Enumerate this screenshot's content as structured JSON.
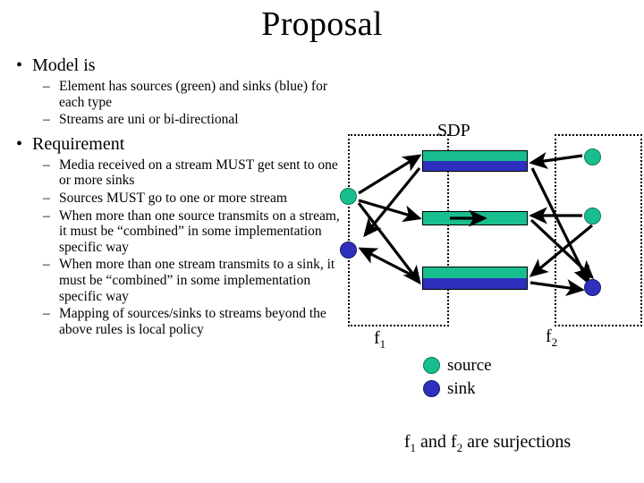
{
  "slide": {
    "title": "Proposal"
  },
  "bullets": [
    {
      "level1": "Model is",
      "marker": "•",
      "sub_marker": "–",
      "level2": [
        "Element has sources (green) and sinks (blue) for each type",
        "Streams are uni or bi-directional"
      ]
    },
    {
      "level1": "Requirement",
      "marker": "•",
      "sub_marker": "–",
      "level2": [
        "Media received on a stream MUST get sent to one or more sinks",
        "Sources MUST go to one or more stream",
        "When more than one source transmits on a stream, it must be “combined” in some implementation specific way",
        "When more than one stream transmits to a sink, it must be “combined” in some implementation specific way",
        "Mapping of sources/sinks to streams beyond the above rules is local policy"
      ]
    }
  ],
  "diagram": {
    "sdp_label": "SDP",
    "f1_label": "f",
    "f1_sub": "1",
    "f2_label": "f",
    "f2_sub": "2",
    "caption_pre": "f",
    "caption_sub1": "1",
    "caption_mid": " and f",
    "caption_sub2": "2",
    "caption_post": " are surjections",
    "colors": {
      "source_green": "#19be8f",
      "sink_blue": "#2f2fbe",
      "arrow_black": "#000000",
      "box_border": "#000000"
    },
    "left_nodes": [
      {
        "id": "left-source",
        "type": "source"
      },
      {
        "id": "left-sink",
        "type": "sink"
      }
    ],
    "right_nodes": [
      {
        "id": "right-source-1",
        "type": "source"
      },
      {
        "id": "right-source-2",
        "type": "source"
      },
      {
        "id": "right-sink-1",
        "type": "sink"
      }
    ],
    "streams": [
      {
        "id": "stream-top",
        "halves": [
          "green",
          "blue"
        ]
      },
      {
        "id": "stream-middle",
        "halves": [
          "green"
        ],
        "inner_arrow": "right"
      },
      {
        "id": "stream-bottom",
        "halves": [
          "green",
          "blue"
        ]
      }
    ],
    "legend": [
      {
        "type": "source",
        "label": "source"
      },
      {
        "type": "sink",
        "label": "sink"
      }
    ]
  }
}
